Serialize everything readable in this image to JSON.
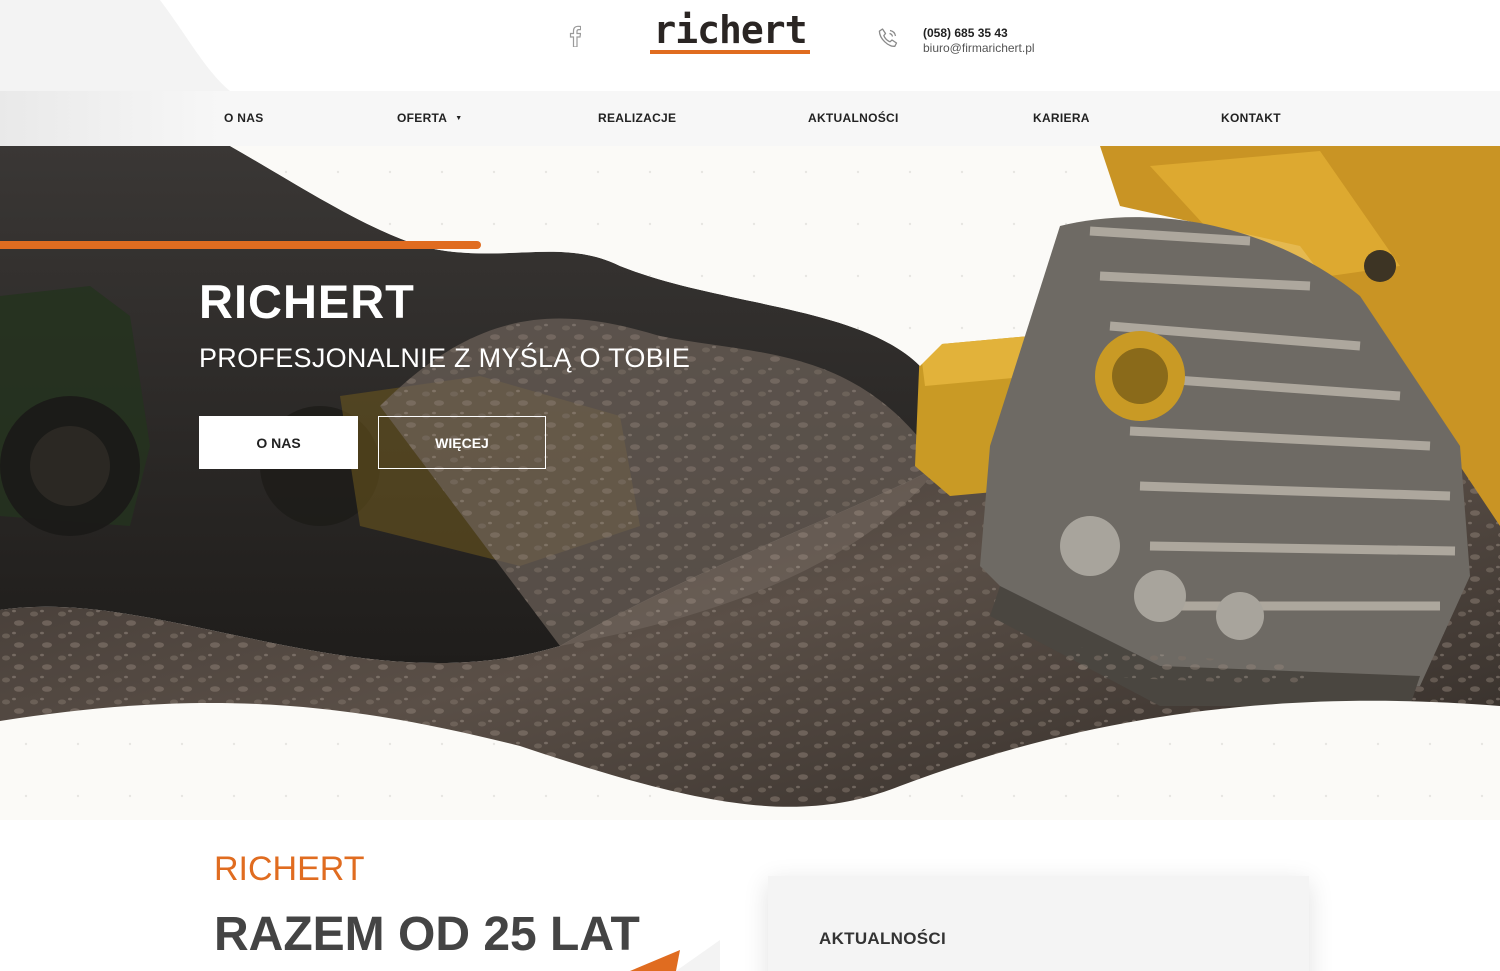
{
  "header": {
    "logo_text": "richert",
    "phone": "(058) 685 35 43",
    "email": "biuro@firmarichert.pl",
    "icons": [
      "facebook-icon",
      "phone-icon"
    ]
  },
  "nav": {
    "items": [
      {
        "label": "O NAS"
      },
      {
        "label": "OFERTA",
        "has_dropdown": true,
        "caret": "▼"
      },
      {
        "label": "REALIZACJE"
      },
      {
        "label": "AKTUALNOŚCI"
      },
      {
        "label": "KARIERA"
      },
      {
        "label": "KONTAKT"
      }
    ]
  },
  "hero": {
    "title": "RICHERT",
    "subtitle": "PROFESJONALNIE Z MYŚLĄ O TOBIE",
    "primary_button": "O NAS",
    "secondary_button": "WIĘCEJ"
  },
  "about": {
    "kicker": "RICHERT",
    "title": "RAZEM OD 25 LAT"
  },
  "news": {
    "heading": "AKTUALNOŚCI"
  },
  "colors": {
    "accent": "#e06c20",
    "dark": "#222222",
    "nav_bg": "#f7f7f7",
    "hero_overlay": "#1e1c1a"
  }
}
